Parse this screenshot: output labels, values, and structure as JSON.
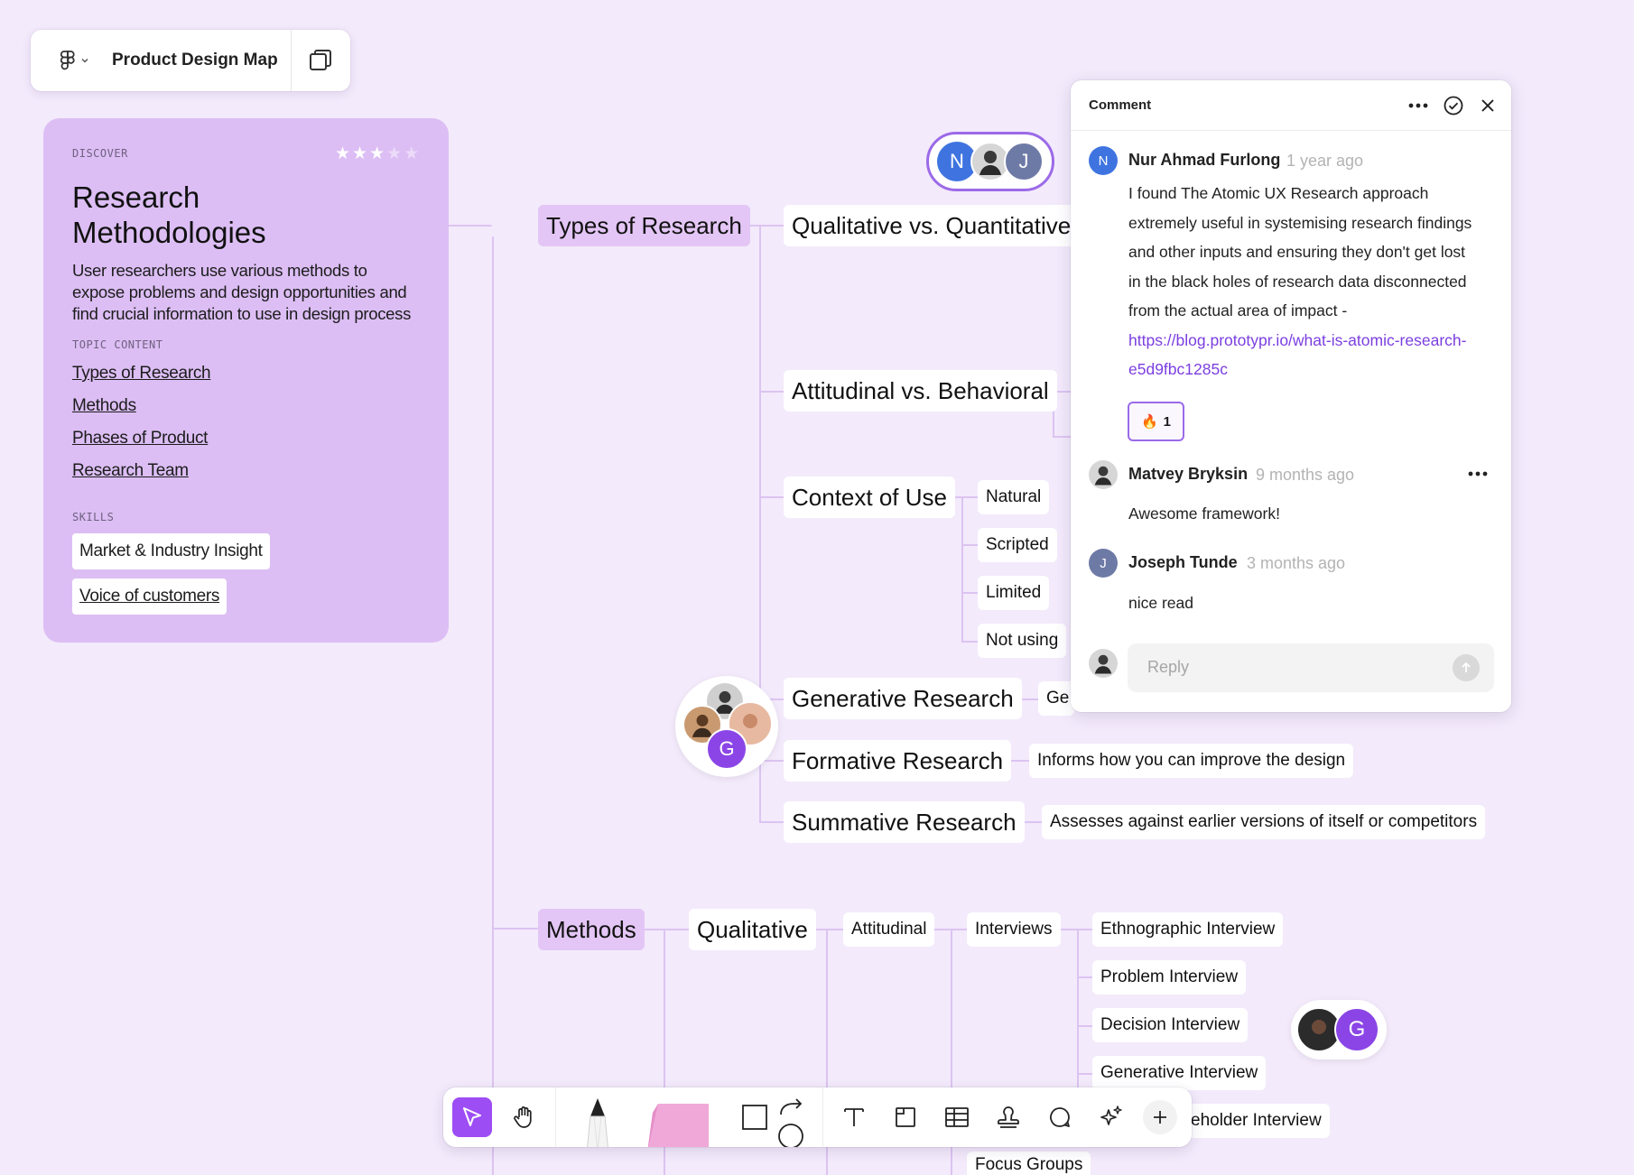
{
  "app": {
    "file_title": "Product Design Map"
  },
  "card": {
    "eyebrow": "DISCOVER",
    "rating": 3,
    "rating_max": 5,
    "title": "Research Methodologies",
    "description": "User researchers use various methods to expose problems and design opportunities and find crucial information to use in design process",
    "topic_content_label": "TOPIC CONTENT",
    "topic_links": [
      "Types of Research",
      "Methods",
      "Phases of Product",
      "Research Team"
    ],
    "skills_label": "SKILLS",
    "skills": [
      "Market & Industry Insight",
      "Voice of customers"
    ]
  },
  "map": {
    "types_of_research": "Types of Research",
    "qual_vs_quant": "Qualitative vs. Quantitative",
    "attitudinal_vs_behavioral": "Attitudinal vs. Behavioral",
    "context_of_use": "Context of Use",
    "context_children": [
      "Natural",
      "Scripted",
      "Limited",
      "Not using"
    ],
    "generative_research": "Generative Research",
    "generative_child_partial": "Ge",
    "formative_research": "Formative Research",
    "formative_desc": "Informs how you can improve the design",
    "summative_research": "Summative Research",
    "summative_desc": "Assesses against earlier versions of itself or competitors",
    "methods": "Methods",
    "qualitative": "Qualitative",
    "attitudinal": "Attitudinal",
    "interviews": "Interviews",
    "interview_types": [
      "Ethnographic Interview",
      "Problem Interview",
      "Decision Interview",
      "Generative Interview",
      "eholder Interview"
    ],
    "focus_groups": "Focus Groups"
  },
  "presence": {
    "top_group": [
      "N",
      "J"
    ],
    "left_group": [
      "G"
    ],
    "right_group": [
      "G"
    ]
  },
  "comments": {
    "panel_title": "Comment",
    "thread": [
      {
        "initial": "N",
        "author": "Nur Ahmad Furlong",
        "time": "1 year ago",
        "text": "I found The Atomic UX Research approach extremely useful in systemising research findings and other inputs and ensuring they don't get lost in the black holes of research data disconnected from the actual area of impact - ",
        "link": "https://blog.prototypr.io/what-is-atomic-research-e5d9fbc1285c",
        "reaction_emoji": "🔥",
        "reaction_count": "1"
      },
      {
        "initial": "",
        "author": "Matvey Bryksin",
        "time": "9 months ago",
        "text": "Awesome framework!"
      },
      {
        "initial": "J",
        "author": "Joseph Tunde",
        "time": "3 months ago",
        "text": "nice read"
      }
    ],
    "reply_placeholder": "Reply"
  },
  "colors": {
    "canvas": "#f3eafb",
    "accent": "#9d4df4",
    "card": "#dcbef4",
    "topic_node": "#e3c6f5",
    "link": "#7b3fe0",
    "avatar_blue": "#3f74e0",
    "avatar_slate": "#6e7aa6",
    "avatar_purple": "#8b45e6"
  },
  "toolbar": {
    "tools": [
      "move-tool",
      "hand-tool",
      "pen-tool",
      "sticky-note-tool",
      "shape-tool",
      "text-tool",
      "section-tool",
      "table-tool",
      "stamp-tool",
      "comment-tool",
      "ai-sparkle-tool",
      "add-tool"
    ]
  }
}
